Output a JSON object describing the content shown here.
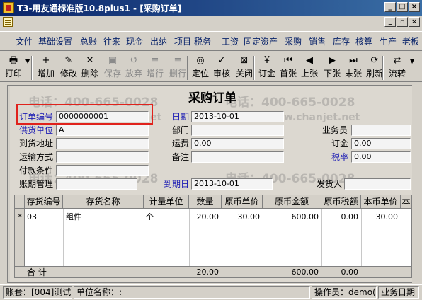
{
  "window": {
    "title": "T3-用友通标准版10.8plus1 - [采购订单]",
    "min": "_",
    "max": "□",
    "close": "×",
    "mdi_min": "_",
    "mdi_restore": "▫",
    "mdi_close": "×"
  },
  "menu": [
    "文件",
    "基础设置",
    "总账",
    "往来",
    "现金",
    "出纳",
    "项目",
    "税务",
    "工资",
    "固定资产",
    "采购",
    "销售",
    "库存",
    "核算",
    "生产",
    "老板"
  ],
  "toolbar": [
    {
      "label": "打印",
      "icon": "🖶",
      "enabled": true
    },
    {
      "label": "增加",
      "icon": "+",
      "enabled": true
    },
    {
      "label": "修改",
      "icon": "✎",
      "enabled": true
    },
    {
      "label": "删除",
      "icon": "✕",
      "enabled": true
    },
    {
      "label": "保存",
      "icon": "▣",
      "enabled": false
    },
    {
      "label": "放弃",
      "icon": "↺",
      "enabled": false
    },
    {
      "label": "增行",
      "icon": "≡",
      "enabled": false
    },
    {
      "label": "删行",
      "icon": "≡",
      "enabled": false
    },
    {
      "label": "定位",
      "icon": "◎",
      "enabled": true
    },
    {
      "label": "审核",
      "icon": "✓",
      "enabled": true
    },
    {
      "label": "关闭",
      "icon": "⊠",
      "enabled": true
    },
    {
      "label": "订金",
      "icon": "¥",
      "enabled": true
    },
    {
      "label": "首张",
      "icon": "⏮",
      "enabled": true
    },
    {
      "label": "上张",
      "icon": "◀",
      "enabled": true
    },
    {
      "label": "下张",
      "icon": "▶",
      "enabled": true
    },
    {
      "label": "末张",
      "icon": "⏭",
      "enabled": true
    },
    {
      "label": "刷新",
      "icon": "⟳",
      "enabled": true
    },
    {
      "label": "流转",
      "icon": "⇄",
      "enabled": true
    }
  ],
  "form": {
    "title": "采购订单",
    "order_no_label": "订单编号",
    "order_no": "0000000001",
    "date_label": "日期",
    "date": "2013-10-01",
    "supplier_label": "供货单位",
    "supplier": "A",
    "dept_label": "部门",
    "dept": "",
    "clerk_label": "业务员",
    "clerk": "",
    "address_label": "到货地址",
    "address": "",
    "freight_label": "运费",
    "freight": "0.00",
    "deposit_label": "订金",
    "deposit": "0.00",
    "transport_label": "运输方式",
    "transport": "",
    "remark_label": "备注",
    "remark": "",
    "tax_rate_label": "税率",
    "tax_rate": "0.00",
    "payment_label": "付款条件",
    "payment": "",
    "account_label": "账期管理",
    "account": "",
    "due_date_label": "到期日",
    "due_date": "2013-10-01",
    "sender_label": "发货人",
    "sender": ""
  },
  "grid": {
    "headers": [
      "存货编号",
      "存货名称",
      "计量单位",
      "数量",
      "原币单价",
      "原币金额",
      "原币税额",
      "本币单价",
      "本"
    ],
    "rows": [
      {
        "marker": "*",
        "code": "03",
        "name": "组件",
        "unit": "个",
        "qty": "20.00",
        "price": "30.00",
        "amount": "600.00",
        "tax": "0.00",
        "local_price": "30.00"
      }
    ],
    "total_label": "合  计",
    "total_qty": "20.00",
    "total_amount": "600.00",
    "total_tax": "0.00"
  },
  "status": {
    "account": "账套：[004]测试",
    "unit": "单位名称：:",
    "operator": "操作员：demo(de",
    "bizdate": "业务日期"
  },
  "watermarks": [
    "电话：400-665-0028",
    "www.chanjet.net"
  ]
}
